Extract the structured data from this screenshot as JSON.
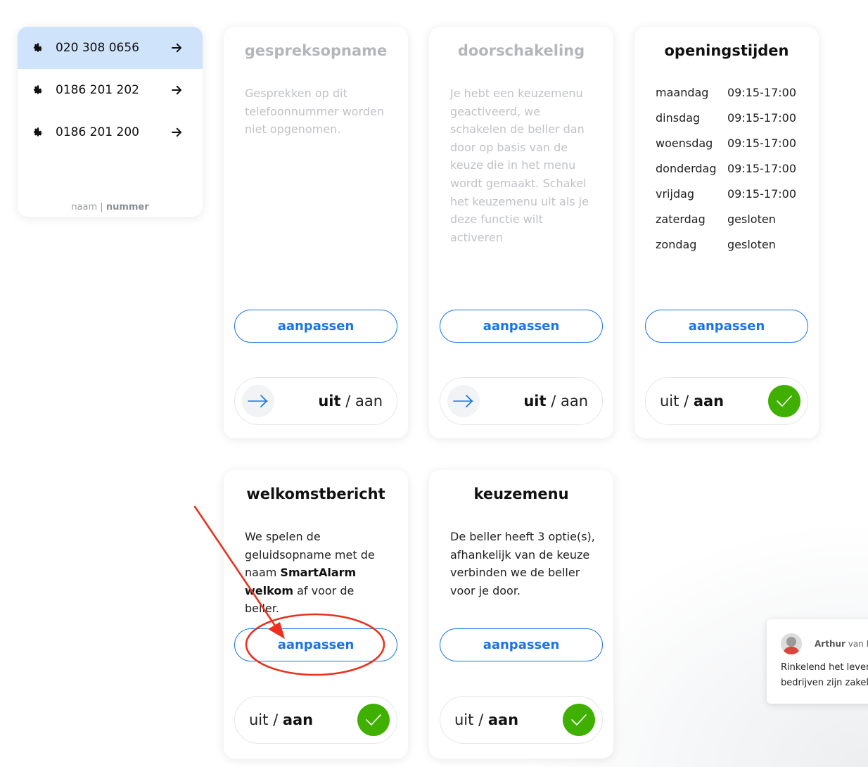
{
  "sidebar": {
    "items": [
      {
        "number": "020 308 0656",
        "active": true
      },
      {
        "number": "0186 201 202",
        "active": false
      },
      {
        "number": "0186 201 200",
        "active": false
      }
    ],
    "toggle_name": "naam",
    "toggle_separator": "|",
    "toggle_number": "nummer"
  },
  "cards": {
    "gespreksopname": {
      "title": "gespreksopname",
      "desc": "Gesprekken op dit telefoonnummer worden niet opgenomen.",
      "button": "aanpassen",
      "toggle_off": "uit",
      "toggle_sep": "/",
      "toggle_on": "aan",
      "state": "uit"
    },
    "doorschakeling": {
      "title": "doorschakeling",
      "desc": "Je hebt een keuzemenu geactiveerd, we schakelen de beller dan door op basis van de keuze die in het menu wordt gemaakt. Schakel het keuzemenu uit als je deze functie wilt activeren",
      "button": "aanpassen",
      "toggle_off": "uit",
      "toggle_sep": "/",
      "toggle_on": "aan",
      "state": "uit"
    },
    "openingstijden": {
      "title": "openingstijden",
      "hours": [
        {
          "day": "maandag",
          "time": "09:15-17:00"
        },
        {
          "day": "dinsdag",
          "time": "09:15-17:00"
        },
        {
          "day": "woensdag",
          "time": "09:15-17:00"
        },
        {
          "day": "donderdag",
          "time": "09:15-17:00"
        },
        {
          "day": "vrijdag",
          "time": "09:15-17:00"
        },
        {
          "day": "zaterdag",
          "time": "gesloten"
        },
        {
          "day": "zondag",
          "time": "gesloten"
        }
      ],
      "button": "aanpassen",
      "toggle_off": "uit",
      "toggle_sep": "/",
      "toggle_on": "aan",
      "state": "aan"
    },
    "welkomstbericht": {
      "title": "welkomstbericht",
      "desc_pre": "We spelen de geluidsopname met de naam ",
      "desc_bold": "SmartAlarm welkom",
      "desc_post": " af voor de beller.",
      "button": "aanpassen",
      "toggle_off": "uit",
      "toggle_sep": "/",
      "toggle_on": "aan",
      "state": "aan"
    },
    "keuzemenu": {
      "title": "keuzemenu",
      "desc": "De beller heeft 3 optie(s), afhankelijk van de keuze verbinden we de beller voor je door.",
      "button": "aanpassen",
      "toggle_off": "uit",
      "toggle_sep": "/",
      "toggle_on": "aan",
      "state": "aan"
    }
  },
  "chat": {
    "author_first": "Arthur",
    "author_rest": " van Ri",
    "line1": "Rinkelend het leven",
    "line2": "bedrijven zijn zakelij"
  },
  "colors": {
    "accent": "#1a73e8",
    "active_item": "#cfe3fb",
    "on_green": "#3fb000",
    "annotation_red": "#e8321e"
  }
}
